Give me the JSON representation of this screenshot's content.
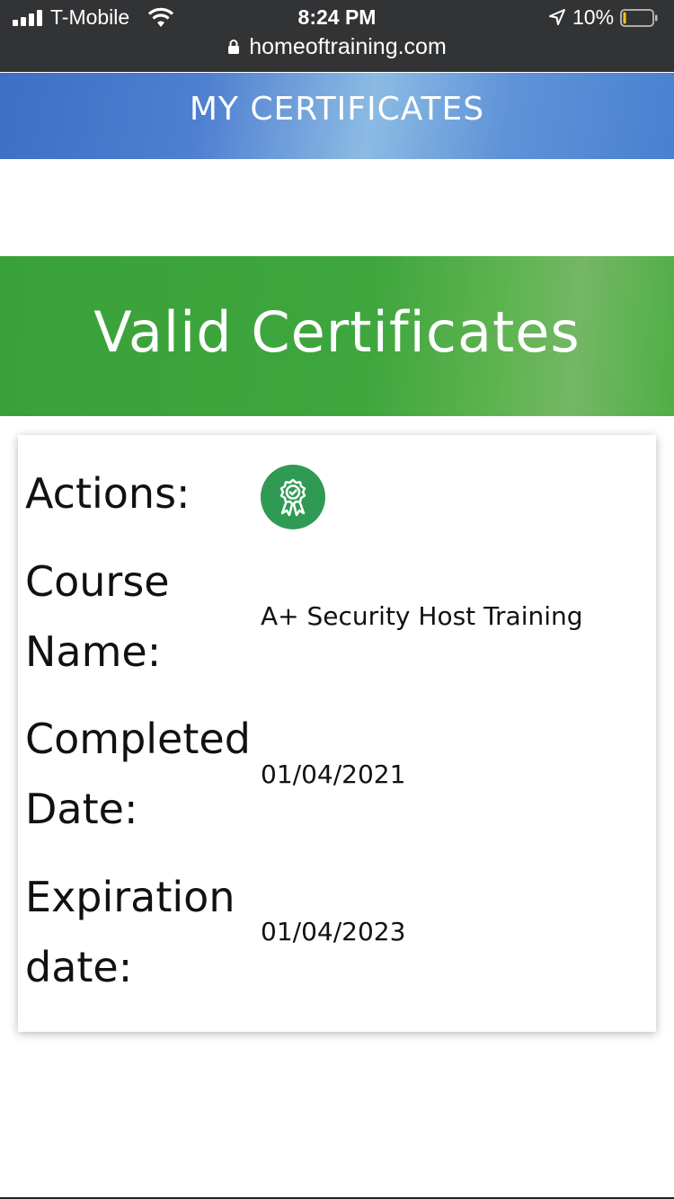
{
  "status_bar": {
    "carrier": "T-Mobile",
    "time": "8:24 PM",
    "battery_percent": "10%",
    "battery_level": 0.1,
    "url": "homeoftraining.com",
    "icons": [
      "signal-icon",
      "wifi-icon",
      "location-icon",
      "battery-icon",
      "lock-icon"
    ]
  },
  "header": {
    "title": "MY CERTIFICATES"
  },
  "section": {
    "title": "Valid Certificates"
  },
  "certificate": {
    "actions_label": "Actions:",
    "action_icon": "certificate-badge-icon",
    "course_label_1": "Course",
    "course_label_2": "Name:",
    "course_name": "A+ Security Host Training",
    "completed_label_1": "Completed",
    "completed_label_2": "Date:",
    "completed_date": "01/04/2021",
    "expiration_label_1": "Expiration",
    "expiration_label_2": "date:",
    "expiration_date": "01/04/2023"
  },
  "colors": {
    "status_bar_bg": "#323335",
    "header_blue": "#4f7fd0",
    "banner_green": "#3fa63e",
    "action_button_green": "#2f9a53"
  }
}
